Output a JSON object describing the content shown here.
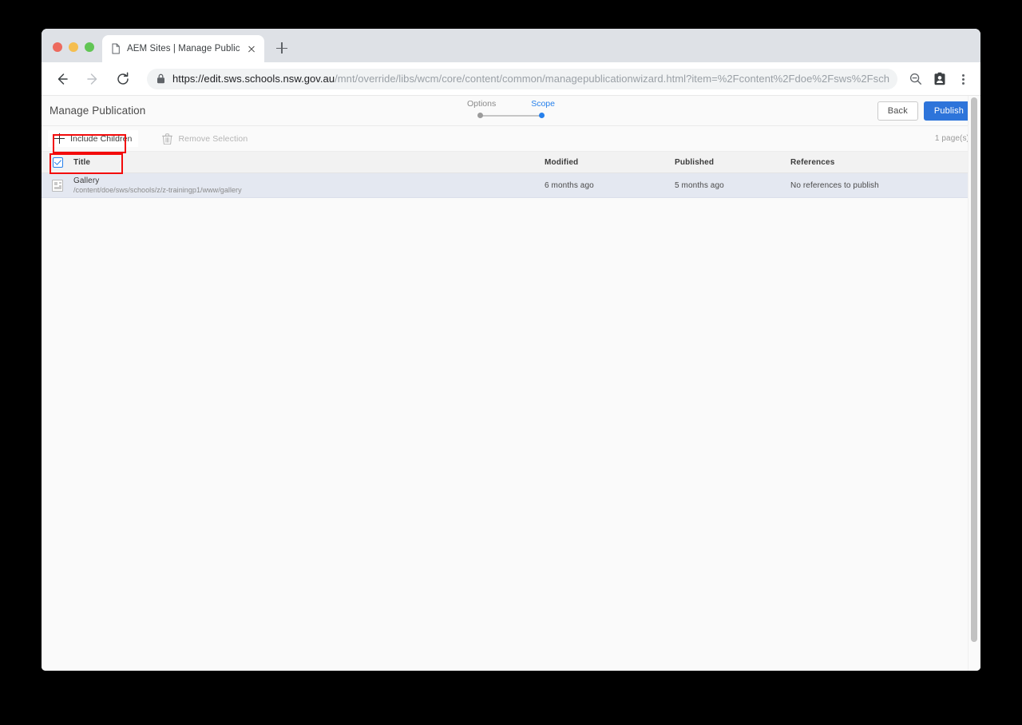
{
  "browser": {
    "tab": {
      "title": "AEM Sites | Manage Publication",
      "favicon": "page-icon",
      "close": "close-icon"
    },
    "new_tab_label": "+",
    "nav": {
      "back": "back-arrow-icon",
      "forward": "forward-arrow-icon",
      "reload": "reload-icon"
    },
    "omnibox": {
      "lock": "lock-icon",
      "url_host": "https://edit.sws.schools.nsw.gov.au",
      "url_path": "/mnt/override/libs/wcm/core/content/common/managepublicationwizard.html?item=%2Fcontent%2Fdoe%2Fsws%2Fsch...",
      "zoom_icon": "zoom-out-icon",
      "profile_icon": "profile-card-icon",
      "menu_icon": "three-dot-menu-icon"
    }
  },
  "app": {
    "title": "Manage Publication",
    "wizard": {
      "steps": [
        {
          "label": "Options",
          "state": "inactive"
        },
        {
          "label": "Scope",
          "state": "active"
        }
      ],
      "active_color": "#2680EB",
      "inactive_color": "#8A8A8A"
    },
    "header_actions": {
      "back_label": "Back",
      "publish_label": "Publish",
      "publish_color": "#2D74DA"
    },
    "action_bar": {
      "include_children_label": "Include Children",
      "remove_selection_label": "Remove Selection",
      "page_count": "1 page(s)"
    },
    "table": {
      "columns": {
        "title": "Title",
        "modified": "Modified",
        "published": "Published",
        "references": "References"
      },
      "select_all_checked": true,
      "rows": [
        {
          "title": "Gallery",
          "path": "/content/doe/sws/schools/z/z-trainingp1/www/gallery",
          "modified": "6 months ago",
          "published": "5 months ago",
          "references": "No references to publish"
        }
      ]
    },
    "highlight_color": "#F30B0B"
  }
}
